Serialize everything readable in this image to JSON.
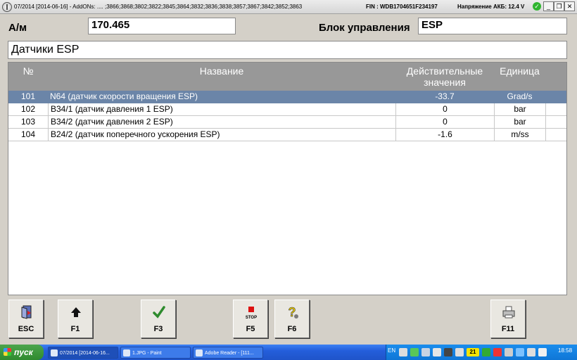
{
  "window": {
    "title": "07/2014 [2014-06-16] - AddONs:  .... ;3866;3868;3802;3822;3845;3864;3832;3836;3838;3857;3867;3842;3852;3863",
    "fin": "FIN : WDB1704651F234197",
    "battery_voltage": "Напряжение АКБ: 12.4 V"
  },
  "header": {
    "am_label": "А/м",
    "am_value": "170.465",
    "control_unit_label": "Блок управления",
    "control_unit_value": "ESP"
  },
  "section_title": "Датчики ESP",
  "table": {
    "columns": {
      "number": "№",
      "name": "Название",
      "actual_values": "Действительные значения",
      "unit": "Единица"
    },
    "rows": [
      {
        "number": "101",
        "name": "N64 (датчик скорости вращения ESP)",
        "value": "-33.7",
        "unit": "Grad/s",
        "selected": true
      },
      {
        "number": "102",
        "name": "B34/1 (датчик давления 1 ESP)",
        "value": "0",
        "unit": "bar",
        "selected": false
      },
      {
        "number": "103",
        "name": "B34/2 (датчик давления 2 ESP)",
        "value": "0",
        "unit": "bar",
        "selected": false
      },
      {
        "number": "104",
        "name": "B24/2 (датчик поперечного ускорения ESP)",
        "value": "-1.6",
        "unit": "m/ss",
        "selected": false
      }
    ]
  },
  "function_keys": {
    "esc": {
      "label": "ESC",
      "icon": "exit-door-icon"
    },
    "f1": {
      "label": "F1",
      "icon": "arrow-up-icon"
    },
    "f3": {
      "label": "F3",
      "icon": "checkmark-icon"
    },
    "f5": {
      "label": "F5",
      "icon": "stop-icon",
      "icon_text": "STOP"
    },
    "f6": {
      "label": "F6",
      "icon": "help-icon"
    },
    "f11": {
      "label": "F11",
      "icon": "printer-icon"
    }
  },
  "taskbar": {
    "start_label": "пуск",
    "tasks": [
      "07/2014 [2014-06-16...",
      "1.JPG - Paint",
      "Adobe Reader - [111..."
    ],
    "language": "EN",
    "badge": "21",
    "clock": "18:58"
  },
  "colors": {
    "selected_row": "#6b85a8",
    "header_row": "#989898",
    "ok_indicator": "#2fb52f",
    "taskbar": "#245edb"
  }
}
